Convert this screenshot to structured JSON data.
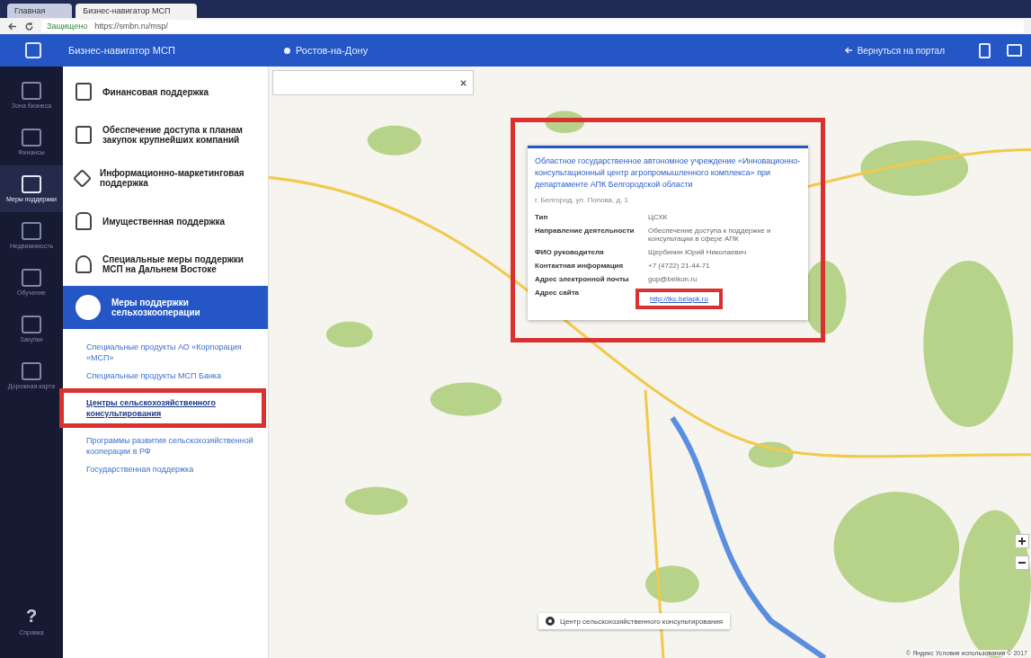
{
  "browser": {
    "tabs": [
      {
        "label": "Главная",
        "selected": false
      },
      {
        "label": "Бизнес-навигатор МСП",
        "selected": true
      }
    ],
    "security": "Защищено",
    "url": "https://smbn.ru/msp/"
  },
  "header": {
    "title": "Бизнес-навигатор МСП",
    "city": "Ростов-на-Дону",
    "back": "Вернуться на портал"
  },
  "rail": [
    {
      "label": "Зона бизнеса",
      "selected": false
    },
    {
      "label": "Финансы",
      "selected": false
    },
    {
      "label": "Меры поддержки",
      "selected": true
    },
    {
      "label": "Недвижимость",
      "selected": false
    },
    {
      "label": "Обучение",
      "selected": false
    },
    {
      "label": "Закупки",
      "selected": false
    },
    {
      "label": "Дорожная карта",
      "selected": false
    }
  ],
  "help": {
    "icon": "?",
    "label": "Справка"
  },
  "menu": [
    {
      "label": "Финансовая поддержка",
      "selected": false
    },
    {
      "label": "Обеспечение доступа к планам закупок крупнейших компаний",
      "selected": false
    },
    {
      "label": "Информационно-маркетинговая поддержка",
      "selected": false
    },
    {
      "label": "Имущественная поддержка",
      "selected": false
    },
    {
      "label": "Специальные меры поддержки МСП на Дальнем Востоке",
      "selected": false
    },
    {
      "label": "Меры поддержки сельхозкооперации",
      "selected": true
    }
  ],
  "submenu": [
    {
      "label": "Специальные продукты АО «Корпорация «МСП»",
      "selected": false
    },
    {
      "label": "Специальные продукты МСП Банка",
      "selected": false
    },
    {
      "label": "Центры сельскохозяйственного консультирования",
      "selected": true
    },
    {
      "label": "Программы развития сельскохозяйственной кооперации в РФ",
      "selected": false
    },
    {
      "label": "Государственная поддержка",
      "selected": false
    }
  ],
  "popup": {
    "title": "Областное государственное автономное учреждение «Инновационно-консультационный центр агропромышленного комплекса» при департаменте АПК Белгородской области",
    "address": "г. Белгород, ул. Попова, д. 1",
    "rows": [
      {
        "label": "Тип",
        "value": "ЦСХК",
        "kind": "text"
      },
      {
        "label": "Направление деятельности",
        "value": "Обеспечение доступа к поддержке и консультации в сфере АПК",
        "kind": "text"
      },
      {
        "label": "ФИО руководителя",
        "value": "Щербинин Юрий Николаевич",
        "kind": "text"
      },
      {
        "label": "Контактная информация",
        "value": "+7 (4722) 21-44-71",
        "kind": "text"
      },
      {
        "label": "Адрес электронной почты",
        "value": "gup@belkon.ru",
        "kind": "text"
      },
      {
        "label": "Адрес сайта",
        "value": "http://ikc.belapk.ru",
        "kind": "link"
      }
    ]
  },
  "legend": {
    "label": "Центр сельскохозяйственного консультирования"
  },
  "attribution": "© Яндекс Условия использования © 2017"
}
